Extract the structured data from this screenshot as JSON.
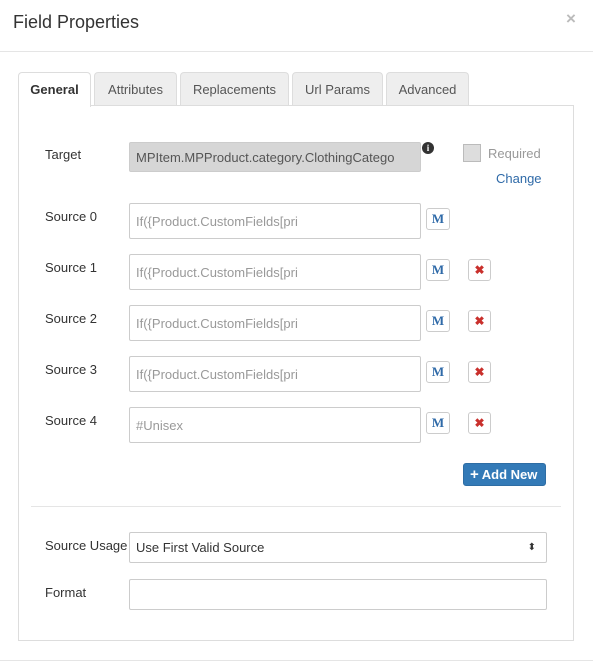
{
  "dialog": {
    "title": "Field Properties",
    "close_glyph": "×"
  },
  "tabs": [
    {
      "label": "General",
      "active": true
    },
    {
      "label": "Attributes",
      "active": false
    },
    {
      "label": "Replacements",
      "active": false
    },
    {
      "label": "Url Params",
      "active": false
    },
    {
      "label": "Advanced",
      "active": false
    }
  ],
  "target": {
    "label": "Target",
    "value": "MPItem.MPProduct.category.ClothingCatego",
    "info_glyph": "i",
    "required_label": "Required",
    "required_checked": false,
    "change_label": "Change"
  },
  "sources": [
    {
      "label": "Source 0",
      "value": "If({Product.CustomFields[pri",
      "m_label": "M",
      "removable": false
    },
    {
      "label": "Source 1",
      "value": "If({Product.CustomFields[pri",
      "m_label": "M",
      "removable": true
    },
    {
      "label": "Source 2",
      "value": "If({Product.CustomFields[pri",
      "m_label": "M",
      "removable": true
    },
    {
      "label": "Source 3",
      "value": "If({Product.CustomFields[pri",
      "m_label": "M",
      "removable": true
    },
    {
      "label": "Source 4",
      "value": "#Unisex",
      "m_label": "M",
      "removable": true
    }
  ],
  "remove_glyph": "✖",
  "add_new": {
    "icon": "+",
    "label": "Add New"
  },
  "source_usage": {
    "label": "Source Usage",
    "value": "Use First Valid Source",
    "caret": "⬍"
  },
  "format": {
    "label": "Format",
    "value": ""
  },
  "colors": {
    "accent": "#337ab7",
    "link": "#2f6aa8",
    "remove": "#c9302c"
  }
}
